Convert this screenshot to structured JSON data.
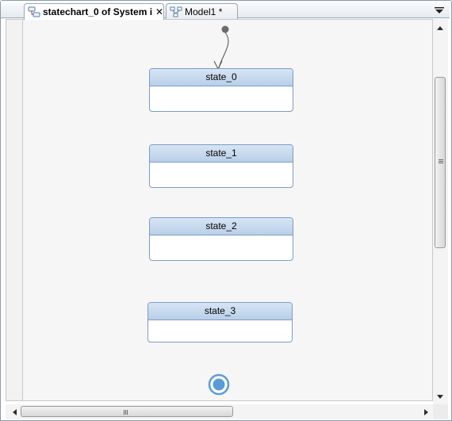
{
  "tabs": {
    "active": {
      "label": "statechart_0 of System in...",
      "close_glyph": "✕",
      "icon": "statechart-icon"
    },
    "inactive": {
      "label": "Model1 *",
      "icon": "model-icon"
    },
    "menu_icon": "chevron-down-icon"
  },
  "diagram": {
    "states": [
      {
        "label": "state_0"
      },
      {
        "label": "state_1"
      },
      {
        "label": "state_2"
      },
      {
        "label": "state_3"
      }
    ],
    "initial_pseudostate": "initial-node-icon",
    "final_state": "final-state-icon"
  },
  "colors": {
    "state_border": "#7d9cc5",
    "state_header": "#c7daf0",
    "final_state": "#5b9bd5",
    "canvas": "#f6f6f6"
  },
  "scrollbars": {
    "vertical": {
      "up_icon": "arrow-up-icon",
      "down_icon": "arrow-down-icon"
    },
    "horizontal": {
      "left_icon": "arrow-left-icon",
      "right_icon": "arrow-right-icon"
    }
  }
}
